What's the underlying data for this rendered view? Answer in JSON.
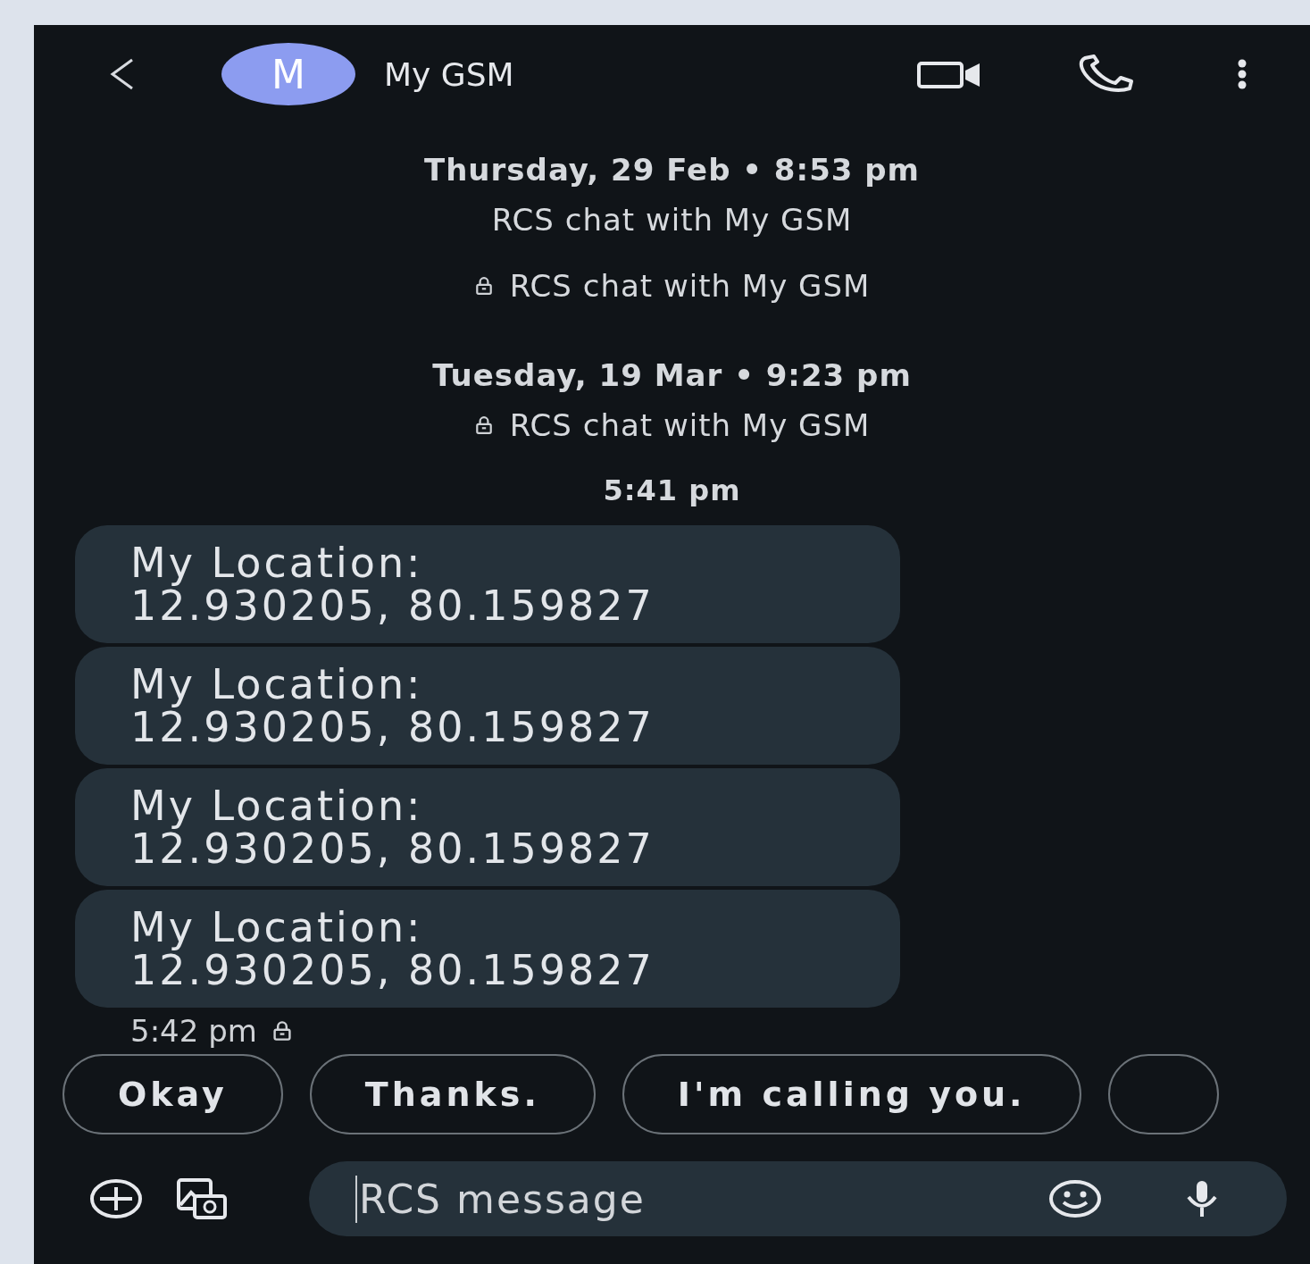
{
  "header": {
    "avatar_letter": "M",
    "contact_name": "My GSM"
  },
  "timeline": [
    {
      "kind": "date",
      "text": "Thursday, 29 Feb • 8:53 pm"
    },
    {
      "kind": "info",
      "text": "RCS chat with My GSM",
      "locked": false
    },
    {
      "kind": "info",
      "text": "RCS chat with My GSM",
      "locked": true
    },
    {
      "kind": "date",
      "text": "Tuesday, 19 Mar • 9:23 pm"
    },
    {
      "kind": "info",
      "text": "RCS chat with My GSM",
      "locked": true
    },
    {
      "kind": "time",
      "text": "5:41 pm"
    }
  ],
  "messages": [
    {
      "line_1": "My Location:",
      "line_2": "12.930205, 80.159827"
    },
    {
      "line_1": "My Location:",
      "line_2": "12.930205, 80.159827"
    },
    {
      "line_1": "My Location:",
      "line_2": "12.930205, 80.159827"
    },
    {
      "line_1": "My Location:",
      "line_2": "12.930205, 80.159827"
    }
  ],
  "last_message_time": {
    "text": "5:42 pm",
    "locked": true
  },
  "smart_replies": [
    "Okay",
    "Thanks.",
    "I'm calling you."
  ],
  "smart_replies_more": true,
  "composer": {
    "placeholder": "RCS message"
  }
}
